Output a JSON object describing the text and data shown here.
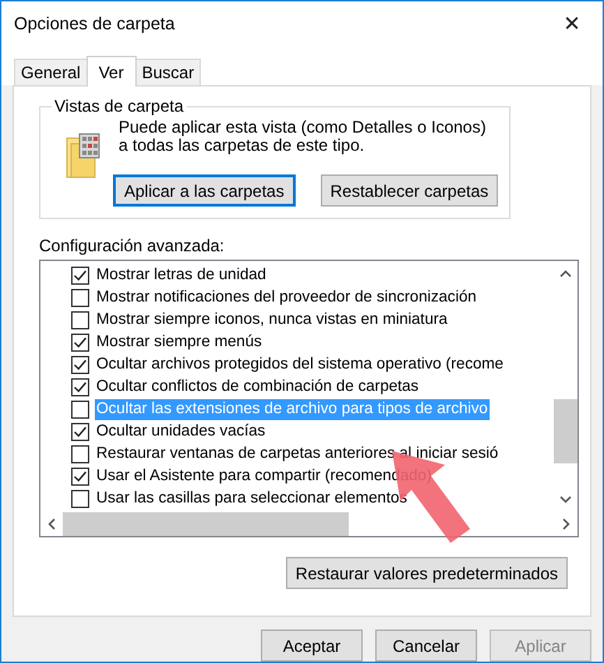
{
  "window": {
    "title": "Opciones de carpeta",
    "close": "✕"
  },
  "tabs": [
    {
      "label": "General",
      "selected": false
    },
    {
      "label": "Ver",
      "selected": true
    },
    {
      "label": "Buscar",
      "selected": false
    }
  ],
  "folder_views": {
    "title": "Vistas de carpeta",
    "description": "Puede aplicar esta vista (como Detalles o Iconos) a todas las carpetas de este tipo.",
    "buttons": [
      {
        "label": "Aplicar a las carpetas",
        "focused": true
      },
      {
        "label": "Restablecer carpetas",
        "focused": false
      }
    ]
  },
  "advanced": {
    "label": "Configuración avanzada:",
    "items": [
      {
        "label": "Mostrar letras de unidad",
        "checked": true,
        "selected": false
      },
      {
        "label": "Mostrar notificaciones del proveedor de sincronización",
        "checked": false,
        "selected": false
      },
      {
        "label": "Mostrar siempre iconos, nunca vistas en miniatura",
        "checked": false,
        "selected": false
      },
      {
        "label": "Mostrar siempre menús",
        "checked": true,
        "selected": false
      },
      {
        "label": "Ocultar archivos protegidos del sistema operativo (recome",
        "checked": true,
        "selected": false
      },
      {
        "label": "Ocultar conflictos de combinación de carpetas",
        "checked": true,
        "selected": false
      },
      {
        "label": "Ocultar las extensiones de archivo para tipos de archivo",
        "checked": false,
        "selected": true
      },
      {
        "label": "Ocultar unidades vacías",
        "checked": true,
        "selected": false
      },
      {
        "label": "Restaurar ventanas de carpetas anteriores al iniciar sesió",
        "checked": false,
        "selected": false
      },
      {
        "label": "Usar el Asistente para compartir (recomendado)",
        "checked": true,
        "selected": false
      },
      {
        "label": "Usar las casillas para seleccionar elementos",
        "checked": false,
        "selected": false
      }
    ],
    "restore_button": "Restaurar valores predeterminados"
  },
  "buttons": [
    {
      "label": "Aceptar",
      "disabled": false
    },
    {
      "label": "Cancelar",
      "disabled": false
    },
    {
      "label": "Aplicar",
      "disabled": true
    }
  ]
}
